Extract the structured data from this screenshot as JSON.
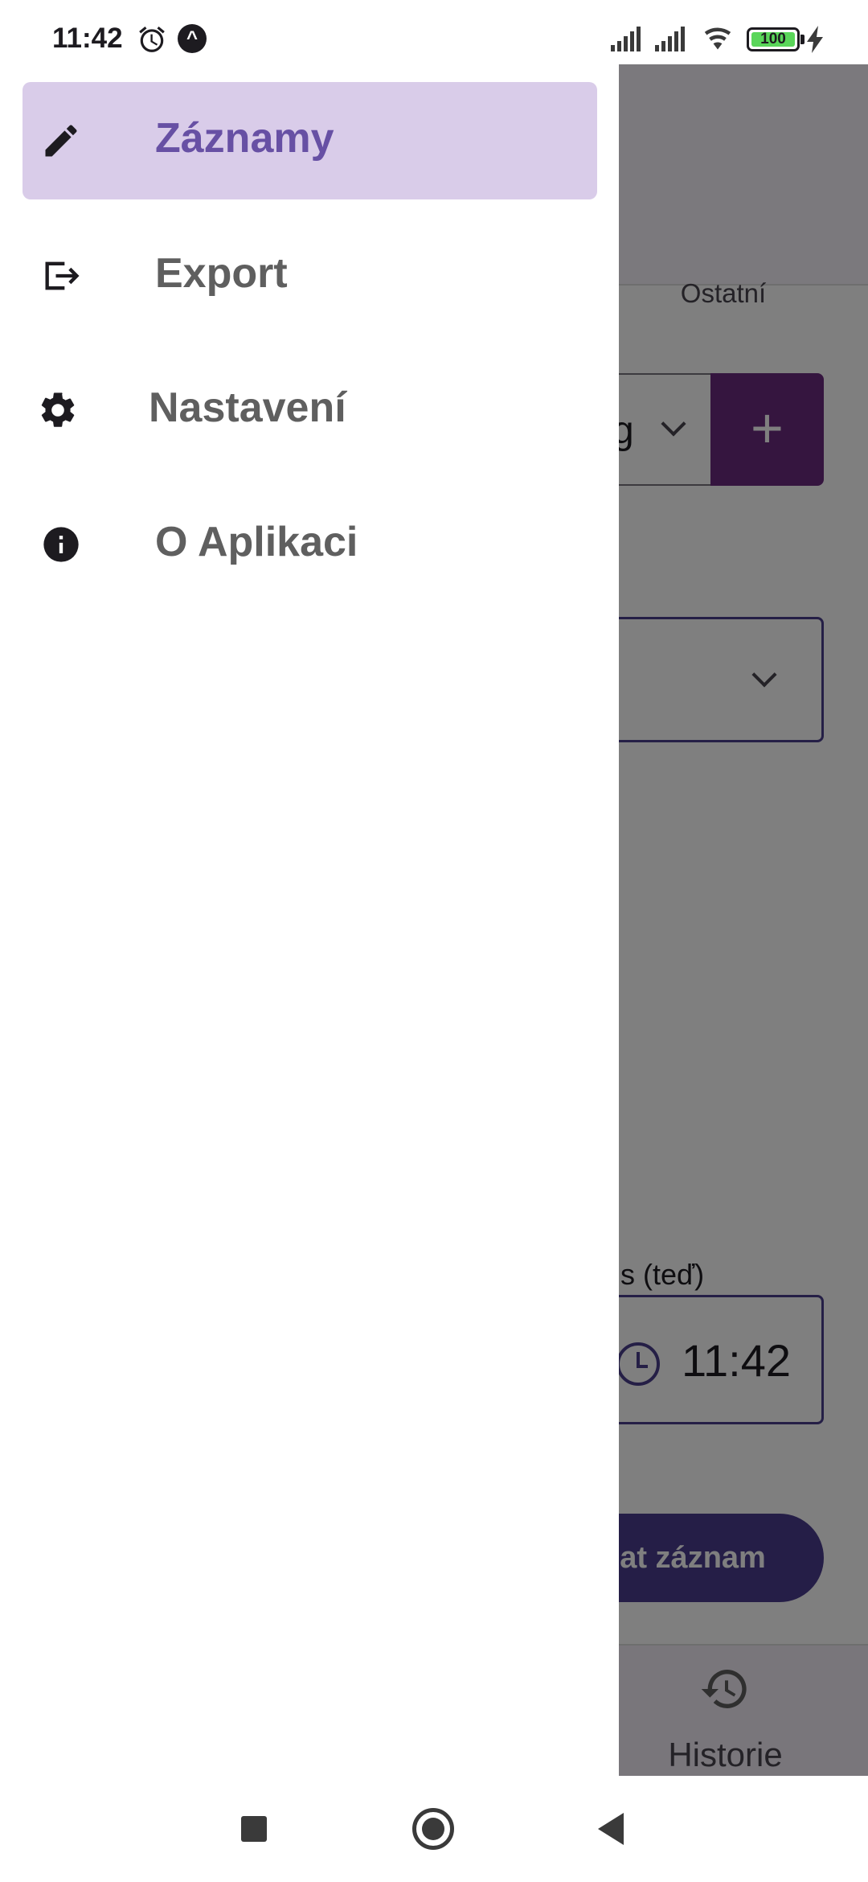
{
  "status_bar": {
    "time": "11:42",
    "battery_level": "100",
    "battery_color": "#5ad65a"
  },
  "drawer": {
    "items": [
      {
        "label": "Záznamy",
        "icon": "pencil-icon",
        "active": true
      },
      {
        "label": "Export",
        "icon": "export-icon",
        "active": false
      },
      {
        "label": "Nastavení",
        "icon": "gear-icon",
        "active": false
      },
      {
        "label": "O Aplikaci",
        "icon": "info-icon",
        "active": false
      }
    ],
    "active_bg_color": "#d9cce9",
    "active_text_color": "#6750a4"
  },
  "background_app": {
    "tab_other": "Ostatní",
    "unit_select_value": "g",
    "add_button_label": "+",
    "time_label": "s (teď)",
    "time_value": "11:42",
    "submit_label": "dat záznam",
    "bottom_nav_history": "Historie",
    "accent_color": "#4a3d8f"
  }
}
